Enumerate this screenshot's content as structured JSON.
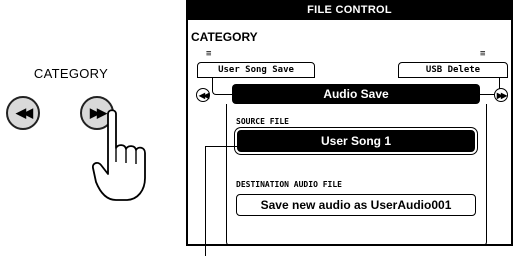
{
  "panel": {
    "category_label": "CATEGORY"
  },
  "display": {
    "title": "FILE CONTROL",
    "category_heading": "CATEGORY",
    "tab_left": "User Song Save",
    "tab_right": "USB Delete",
    "header": "Audio Save",
    "source_label": "SOURCE FILE",
    "source_value": "User Song 1",
    "destination_label": "DESTINATION AUDIO FILE",
    "destination_value": "Save new audio as UserAudio001"
  },
  "icons": {
    "prev": "rewind-icon",
    "next": "fast-forward-icon",
    "hand": "pointing-hand-icon"
  }
}
